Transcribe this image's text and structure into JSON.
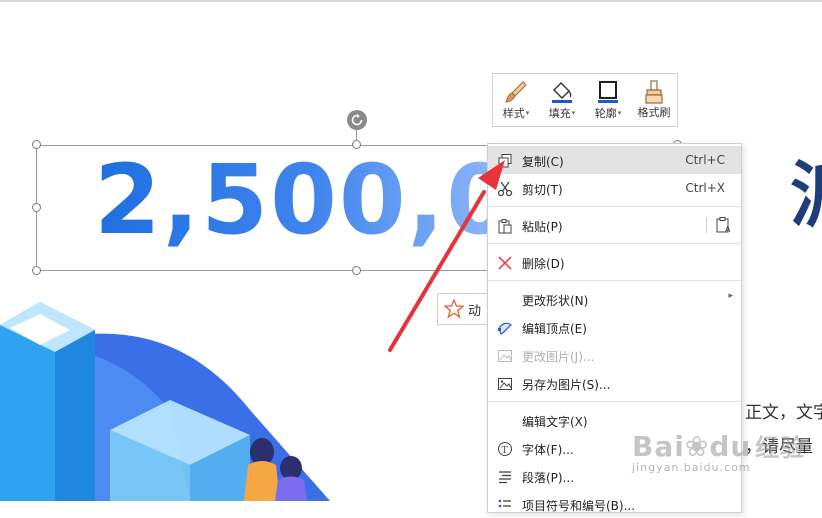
{
  "slide": {
    "big_number": "2,500,0",
    "big_char": "派",
    "paragraph_line1": "正文，文字",
    "paragraph_line2": "，请尽量"
  },
  "mini_toolbar": {
    "items": [
      {
        "label": "样式",
        "icon": "brush-style-icon",
        "has_dropdown": true
      },
      {
        "label": "填充",
        "icon": "fill-bucket-icon",
        "has_dropdown": true
      },
      {
        "label": "轮廓",
        "icon": "outline-box-icon",
        "has_dropdown": true
      },
      {
        "label": "格式刷",
        "icon": "format-painter-icon",
        "has_dropdown": false
      }
    ]
  },
  "animation_button": {
    "label": "动"
  },
  "context_menu": {
    "items": [
      {
        "label": "复制(C)",
        "shortcut": "Ctrl+C",
        "icon": "copy-icon",
        "highlighted": true
      },
      {
        "label": "剪切(T)",
        "shortcut": "Ctrl+X",
        "icon": "scissors-icon"
      },
      {
        "label": "粘贴(P)",
        "icon": "paste-icon"
      },
      {
        "label": "删除(D)",
        "icon": "delete-x-icon"
      },
      {
        "label": "更改形状(N)",
        "has_submenu": true
      },
      {
        "label": "编辑顶点(E)",
        "icon": "edit-vertex-icon"
      },
      {
        "label": "更改图片(J)...",
        "icon": "change-picture-icon",
        "disabled": true
      },
      {
        "label": "另存为图片(S)...",
        "icon": "save-picture-icon"
      },
      {
        "label": "编辑文字(X)"
      },
      {
        "label": "字体(F)...",
        "icon": "font-icon"
      },
      {
        "label": "段落(P)...",
        "icon": "paragraph-icon"
      },
      {
        "label": "项目符号和编号(B)...",
        "icon": "bullets-icon"
      }
    ]
  },
  "watermark": {
    "brand": "Bai",
    "brand_tail": "du",
    "brand_cn": "经验",
    "url": "jingyan.baidu.com"
  },
  "colors": {
    "accent": "#1f6fe0",
    "annotation_arrow": "#e8333a",
    "menu_highlight": "#e3e3e3"
  }
}
